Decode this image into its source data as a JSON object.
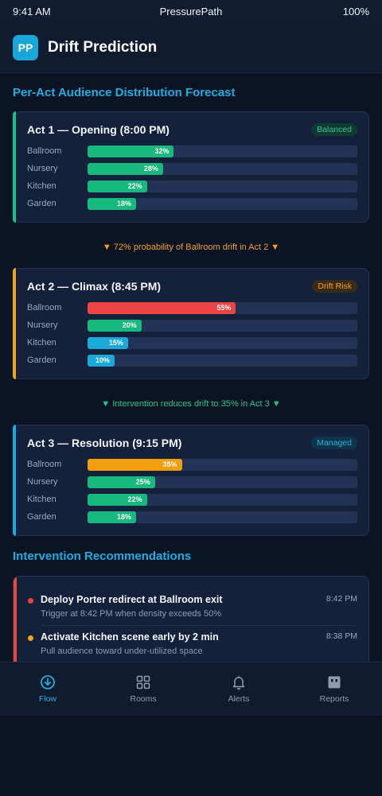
{
  "status": {
    "time": "9:41 AM",
    "app": "PressurePath",
    "battery": "100%"
  },
  "header": {
    "logo": "PP",
    "title": "Drift Prediction"
  },
  "forecast": {
    "title": "Per-Act Audience Distribution Forecast",
    "acts": [
      {
        "title": "Act 1 — Opening (8:00 PM)",
        "badge": "Balanced",
        "badge_type": "balanced",
        "accent": "#1fbf84",
        "rooms": [
          {
            "label": "Ballroom",
            "value": 32,
            "text": "32%",
            "color": "#17b97f"
          },
          {
            "label": "Nursery",
            "value": 28,
            "text": "28%",
            "color": "#17b97f"
          },
          {
            "label": "Kitchen",
            "value": 22,
            "text": "22%",
            "color": "#17b97f"
          },
          {
            "label": "Garden",
            "value": 18,
            "text": "18%",
            "color": "#17b97f"
          }
        ]
      },
      {
        "title": "Act 2 — Climax (8:45 PM)",
        "badge": "Drift Risk",
        "badge_type": "risk",
        "accent": "#f2a21d",
        "rooms": [
          {
            "label": "Ballroom",
            "value": 55,
            "text": "55%",
            "color": "#ef4444"
          },
          {
            "label": "Nursery",
            "value": 20,
            "text": "20%",
            "color": "#17b97f"
          },
          {
            "label": "Kitchen",
            "value": 15,
            "text": "15%",
            "color": "#1aa9d9"
          },
          {
            "label": "Garden",
            "value": 10,
            "text": "10%",
            "color": "#1aa9d9"
          }
        ]
      },
      {
        "title": "Act 3 — Resolution (9:15 PM)",
        "badge": "Managed",
        "badge_type": "managed",
        "accent": "#1aa9d9",
        "rooms": [
          {
            "label": "Ballroom",
            "value": 35,
            "text": "35%",
            "color": "#f29f0f"
          },
          {
            "label": "Nursery",
            "value": 25,
            "text": "25%",
            "color": "#17b97f"
          },
          {
            "label": "Kitchen",
            "value": 22,
            "text": "22%",
            "color": "#17b97f"
          },
          {
            "label": "Garden",
            "value": 18,
            "text": "18%",
            "color": "#17b97f"
          }
        ]
      }
    ],
    "connectors": [
      "▼ 72% probability of Ballroom drift in Act 2 ▼",
      "▼ Intervention reduces drift to 35% in Act 3 ▼"
    ]
  },
  "interventions": {
    "title": "Intervention Recommendations",
    "items": [
      {
        "title": "Deploy Porter redirect at Ballroom exit",
        "subtitle": "Trigger at 8:42 PM when density exceeds 50%",
        "time": "8:42 PM",
        "dot": "#ef4444"
      },
      {
        "title": "Activate Kitchen scene early by 2 min",
        "subtitle": "Pull audience toward under-utilized space",
        "time": "8:38 PM",
        "dot": "#f2a21d"
      }
    ]
  },
  "tabs": [
    {
      "label": "Flow",
      "icon": "flow-icon",
      "active": true
    },
    {
      "label": "Rooms",
      "icon": "grid-icon",
      "active": false
    },
    {
      "label": "Alerts",
      "icon": "bell-icon",
      "active": false
    },
    {
      "label": "Reports",
      "icon": "report-icon",
      "active": false
    }
  ]
}
